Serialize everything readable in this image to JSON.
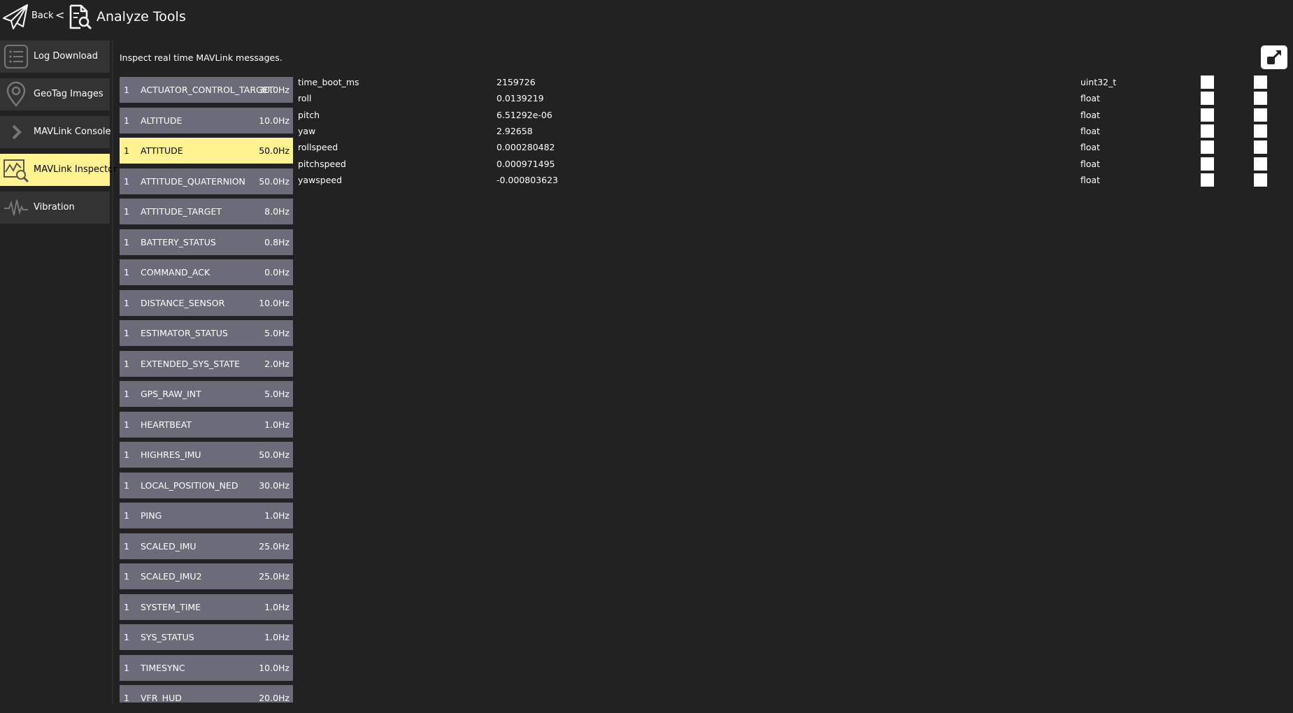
{
  "header": {
    "back_label": "Back",
    "separator": "<",
    "title": "Analyze Tools"
  },
  "sidebar": {
    "items": [
      {
        "label": "Log Download",
        "icon": "list-icon",
        "active": false
      },
      {
        "label": "GeoTag Images",
        "icon": "map-pin-icon",
        "active": false
      },
      {
        "label": "MAVLink Console",
        "icon": "chevron-right-icon",
        "active": false
      },
      {
        "label": "MAVLink Inspector",
        "icon": "chart-magnifier-icon",
        "active": true
      },
      {
        "label": "Vibration",
        "icon": "waveform-icon",
        "active": false
      }
    ]
  },
  "main": {
    "subtitle": "Inspect real time MAVLink messages.",
    "popout_icon": "popout-icon",
    "messages": [
      {
        "count": "1",
        "name": "ACTUATOR_CONTROL_TARGET",
        "rate": "30.0Hz"
      },
      {
        "count": "1",
        "name": "ALTITUDE",
        "rate": "10.0Hz"
      },
      {
        "count": "1",
        "name": "ATTITUDE",
        "rate": "50.0Hz",
        "selected": true
      },
      {
        "count": "1",
        "name": "ATTITUDE_QUATERNION",
        "rate": "50.0Hz"
      },
      {
        "count": "1",
        "name": "ATTITUDE_TARGET",
        "rate": "8.0Hz"
      },
      {
        "count": "1",
        "name": "BATTERY_STATUS",
        "rate": "0.8Hz"
      },
      {
        "count": "1",
        "name": "COMMAND_ACK",
        "rate": "0.0Hz"
      },
      {
        "count": "1",
        "name": "DISTANCE_SENSOR",
        "rate": "10.0Hz"
      },
      {
        "count": "1",
        "name": "ESTIMATOR_STATUS",
        "rate": "5.0Hz"
      },
      {
        "count": "1",
        "name": "EXTENDED_SYS_STATE",
        "rate": "2.0Hz"
      },
      {
        "count": "1",
        "name": "GPS_RAW_INT",
        "rate": "5.0Hz"
      },
      {
        "count": "1",
        "name": "HEARTBEAT",
        "rate": "1.0Hz"
      },
      {
        "count": "1",
        "name": "HIGHRES_IMU",
        "rate": "50.0Hz"
      },
      {
        "count": "1",
        "name": "LOCAL_POSITION_NED",
        "rate": "30.0Hz"
      },
      {
        "count": "1",
        "name": "PING",
        "rate": "1.0Hz"
      },
      {
        "count": "1",
        "name": "SCALED_IMU",
        "rate": "25.0Hz"
      },
      {
        "count": "1",
        "name": "SCALED_IMU2",
        "rate": "25.0Hz"
      },
      {
        "count": "1",
        "name": "SYSTEM_TIME",
        "rate": "1.0Hz"
      },
      {
        "count": "1",
        "name": "SYS_STATUS",
        "rate": "1.0Hz"
      },
      {
        "count": "1",
        "name": "TIMESYNC",
        "rate": "10.0Hz"
      },
      {
        "count": "1",
        "name": "VFR_HUD",
        "rate": "20.0Hz"
      }
    ],
    "fields": [
      {
        "name": "time_boot_ms",
        "value": "2159726",
        "type": "uint32_t"
      },
      {
        "name": "roll",
        "value": "0.0139219",
        "type": "float"
      },
      {
        "name": "pitch",
        "value": "6.51292e-06",
        "type": "float"
      },
      {
        "name": "yaw",
        "value": "2.92658",
        "type": "float"
      },
      {
        "name": "rollspeed",
        "value": "0.000280482",
        "type": "float"
      },
      {
        "name": "pitchspeed",
        "value": "0.000971495",
        "type": "float"
      },
      {
        "name": "yawspeed",
        "value": "-0.000803623",
        "type": "float"
      }
    ]
  },
  "colors": {
    "background": "#222222",
    "panel": "#333333",
    "row": "#6b6b79",
    "highlight": "#fff291"
  }
}
